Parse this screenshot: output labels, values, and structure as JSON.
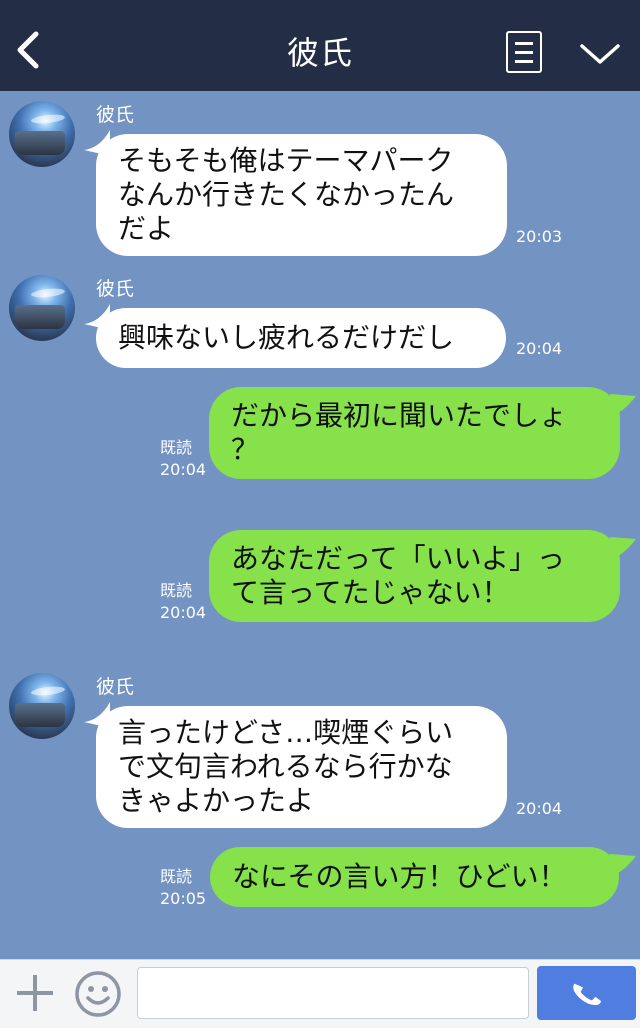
{
  "header": {
    "title": "彼氏",
    "back_icon": "chevron-left-icon",
    "menu_icon": "list-icon",
    "more_icon": "chevron-down-icon",
    "background": "#232d45"
  },
  "chat": {
    "background": "#7393c3",
    "messages": [
      {
        "dir": "in",
        "sender": "彼氏",
        "text": "そもそも俺はテーマパーク\nなんか行きたくなかったん\nだよ",
        "time": "20:03"
      },
      {
        "dir": "in",
        "sender": "彼氏",
        "text": "興味ないし疲れるだけだし",
        "time": "20:04"
      },
      {
        "dir": "out",
        "read": "既読",
        "text": "だから最初に聞いたでしょ\n？",
        "time": "20:04"
      },
      {
        "dir": "out",
        "read": "既読",
        "text": "あなただって「いいよ」っ\nて言ってたじゃない！",
        "time": "20:04"
      },
      {
        "dir": "in",
        "sender": "彼氏",
        "text": "言ったけどさ…喫煙ぐらい\nで文句言われるなら行かな\nきゃよかったよ",
        "time": "20:04"
      },
      {
        "dir": "out",
        "read": "既読",
        "text": "なにその言い方！ひどい！",
        "time": "20:05"
      }
    ]
  },
  "footer": {
    "add_icon": "plus-icon",
    "emoji_icon": "smiley-icon",
    "input_value": "",
    "input_placeholder": "",
    "call_icon": "phone-icon",
    "call_color": "#4f7ee0"
  }
}
